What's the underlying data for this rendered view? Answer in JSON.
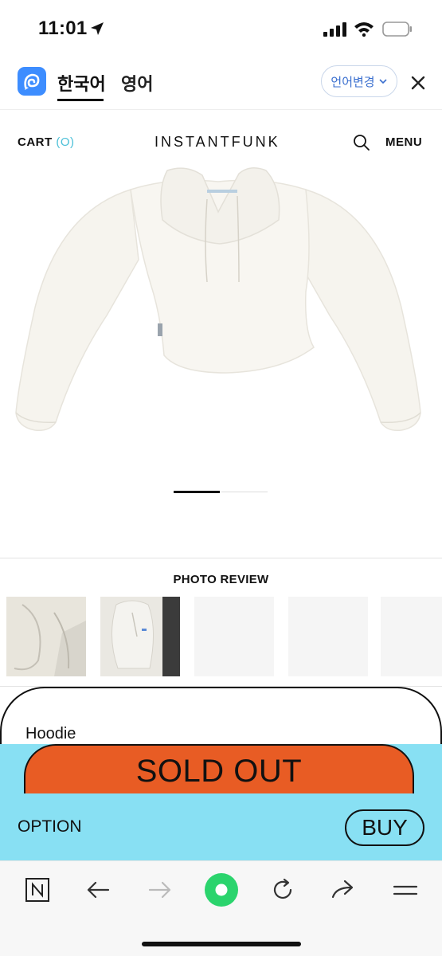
{
  "status_bar": {
    "time": "11:01"
  },
  "translate_bar": {
    "tab_source": "한국어",
    "tab_target": "영어",
    "language_change": "언어변경"
  },
  "header": {
    "cart_label": "CART",
    "cart_count": "(O)",
    "brand": "INSTANTFUNK",
    "menu_label": "MENU"
  },
  "carousel": {
    "active_index": 1,
    "total": 2
  },
  "photo_review": {
    "title": "PHOTO REVIEW",
    "thumbnails": [
      "review-photo-1",
      "review-photo-2",
      "empty",
      "empty",
      "empty"
    ]
  },
  "purchase_sheet": {
    "product_name": "Hoodie",
    "sold_out_label": "SOLD OUT",
    "option_label": "OPTION",
    "buy_label": "BUY"
  },
  "browser_toolbar": {
    "icons": [
      "naver-n-icon",
      "back-arrow-icon",
      "forward-arrow-icon",
      "green-home-icon",
      "reload-icon",
      "share-icon",
      "menu-lines-icon"
    ]
  },
  "colors": {
    "accent_cyan": "#88e0f3",
    "sold_out_orange": "#e85c24",
    "translate_blue": "#3a6fcf",
    "cart_count_cyan": "#4cc0d8",
    "home_green": "#2bd46d"
  }
}
